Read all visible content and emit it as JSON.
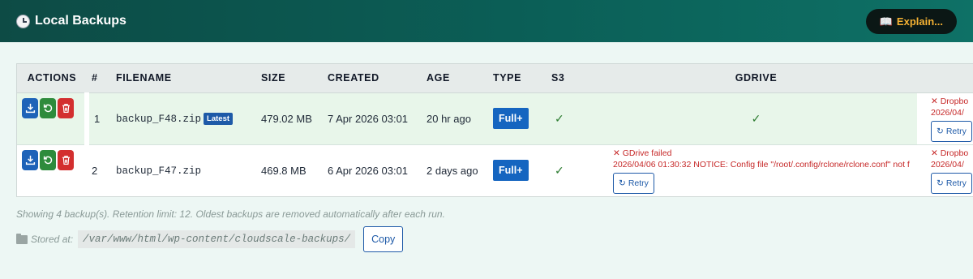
{
  "header": {
    "title": "Local Backups",
    "clock_icon": "clock-icon",
    "explain_label": "Explain...",
    "explain_icon": "book-icon",
    "colors": {
      "bar_start": "#0d4b45",
      "bar_end": "#0e7166",
      "explain_text": "#f5b233"
    }
  },
  "table": {
    "columns": [
      "ACTIONS",
      "#",
      "FILENAME",
      "SIZE",
      "CREATED",
      "AGE",
      "TYPE",
      "S3",
      "GDRIVE"
    ],
    "rows": [
      {
        "index": "1",
        "filename": "backup_F48.zip",
        "badge": "Latest",
        "size": "479.02 MB",
        "created": "7 Apr 2026 03:01",
        "age": "20 hr ago",
        "type": "Full+",
        "s3": "✓",
        "gdrive": "✓",
        "dropbox_title": "✕ Dropbo",
        "dropbox_msg": "2026/04/",
        "dropbox_retry": "Retry"
      },
      {
        "index": "2",
        "filename": "backup_F47.zip",
        "badge": "",
        "size": "469.8 MB",
        "created": "6 Apr 2026 03:01",
        "age": "2 days ago",
        "type": "Full+",
        "s3": "✓",
        "gdrive_title": "✕ GDrive failed",
        "gdrive_msg": "2026/04/06 01:30:32 NOTICE: Config file \"/root/.config/rclone/rclone.conf\" not f",
        "gdrive_retry": "Retry",
        "dropbox_title": "✕ Dropbo",
        "dropbox_msg": "2026/04/",
        "dropbox_retry": "Retry"
      }
    ],
    "action_icons": [
      "download-icon",
      "restore-icon",
      "trash-icon"
    ]
  },
  "footer": {
    "note": "Showing 4 backup(s). Retention limit: 12. Oldest backups are removed automatically after each run.",
    "stored_label": "Stored at:",
    "path": "/var/www/html/wp-content/cloudscale-backups/",
    "copy_label": "Copy"
  }
}
